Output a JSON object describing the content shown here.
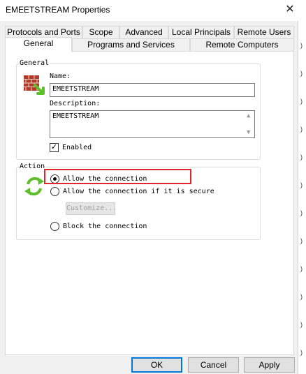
{
  "window": {
    "title": "EMEETSTREAM Properties",
    "close_glyph": "✕"
  },
  "tabs_row1": [
    "Protocols and Ports",
    "Scope",
    "Advanced",
    "Local Principals",
    "Remote Users"
  ],
  "tabs_row2": [
    "General",
    "Programs and Services",
    "Remote Computers"
  ],
  "general": {
    "legend": "General",
    "name_label": "Name:",
    "name_value": "EMEETSTREAM",
    "description_label": "Description:",
    "description_value": "EMEETSTREAM",
    "enabled_label": "Enabled",
    "enabled_checked": true
  },
  "action": {
    "legend": "Action",
    "options": [
      "Allow the connection",
      "Allow the connection if it is secure",
      "Block the connection"
    ],
    "selected_index": 0,
    "customize_label": "Customize..."
  },
  "buttons": {
    "ok": "OK",
    "cancel": "Cancel",
    "apply": "Apply"
  },
  "colors": {
    "highlight": "#e0232e",
    "accent": "#0078d7",
    "icon_green": "#5cbf2a",
    "wall_red": "#b53a2a"
  }
}
